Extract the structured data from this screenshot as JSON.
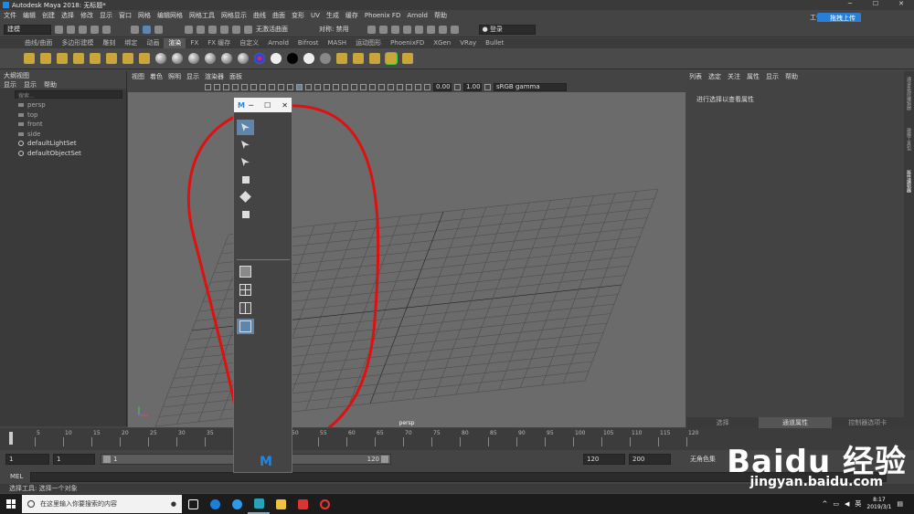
{
  "window": {
    "title": "Autodesk Maya 2018: 无标题*",
    "min": "─",
    "max": "☐",
    "close": "✕"
  },
  "menubar": [
    "文件",
    "编辑",
    "创建",
    "选择",
    "修改",
    "显示",
    "窗口",
    "网格",
    "编辑网格",
    "网格工具",
    "网格显示",
    "曲线",
    "曲面",
    "变形",
    "UV",
    "生成",
    "缓存",
    "Phoenix FD",
    "Arnold",
    "帮助"
  ],
  "workspace_label": "工作",
  "upload_button": "拖拽上传",
  "status": {
    "mode": "建模",
    "live_surface": "无激活曲面",
    "symmetry": "对称: 禁用",
    "login": "登录"
  },
  "shelf_tabs": [
    "曲线/曲面",
    "多边形建模",
    "雕刻",
    "绑定",
    "动画",
    "渲染",
    "FX",
    "FX 缓存",
    "自定义",
    "Arnold",
    "Bifrost",
    "MASH",
    "运动图形",
    "PhoenixFD",
    "XGen",
    "VRay",
    "Bullet"
  ],
  "shelf_active_tab": "渲染",
  "outliner": {
    "title": "大纲视图",
    "menu": [
      "显示",
      "显示",
      "帮助"
    ],
    "search_placeholder": "搜索...",
    "items": [
      "persp",
      "top",
      "front",
      "side",
      "defaultLightSet",
      "defaultObjectSet"
    ]
  },
  "viewport": {
    "menu": [
      "视图",
      "着色",
      "照明",
      "显示",
      "渲染器",
      "面板"
    ],
    "exposure": "0.00",
    "gamma": "1.00",
    "color_space": "sRGB gamma",
    "camera_label": "persp"
  },
  "attribute_editor": {
    "menu": [
      "列表",
      "选定",
      "关注",
      "属性",
      "显示",
      "帮助"
    ],
    "message": "进行选择以查看属性",
    "tabs": [
      "选择",
      "通道属性",
      "控制器选项卡"
    ]
  },
  "side_tabs": [
    "通道盒/层编辑器",
    "建模工具包",
    "属性编辑器"
  ],
  "time_slider": {
    "ticks": [
      "5",
      "10",
      "15",
      "20",
      "25",
      "30",
      "35",
      "40",
      "45",
      "50",
      "55",
      "60",
      "65",
      "70",
      "75",
      "80",
      "85",
      "90",
      "95",
      "100",
      "105",
      "110",
      "115",
      "120"
    ]
  },
  "range_slider": {
    "start": "1",
    "current": "1",
    "range_start": "1",
    "range_end": "120",
    "end": "120",
    "max_end": "200",
    "character_set": "无角色集"
  },
  "command_line": {
    "label": "MEL"
  },
  "help_line": "选择工具: 选择一个对象",
  "toolbox": {
    "title_icon": "M",
    "logo": "M"
  },
  "taskbar": {
    "search_placeholder": "在这里输入你要搜索的内容",
    "time": "8:17",
    "date": "2019/3/1",
    "ime": "英"
  },
  "watermark": {
    "brand": "Baidu 经验",
    "url": "jingyan.baidu.com"
  }
}
